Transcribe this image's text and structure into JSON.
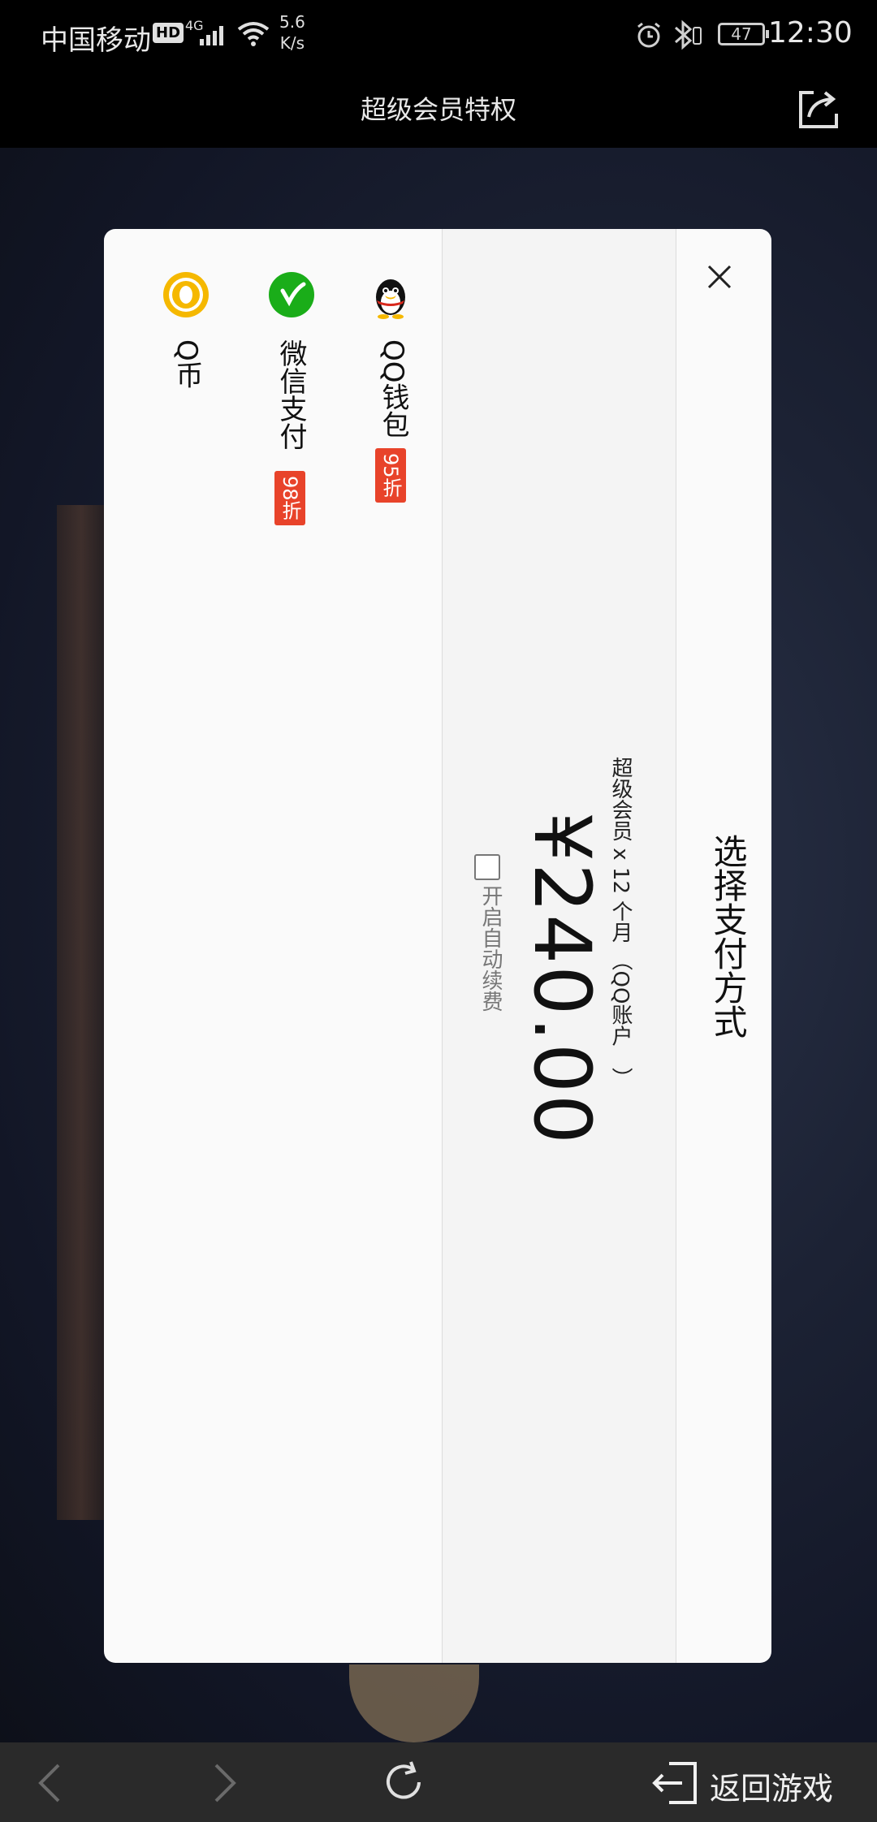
{
  "status_bar": {
    "carrier": "中国移动",
    "hd": "HD",
    "network": "4G",
    "speed_value": "5.6",
    "speed_unit": "K/s",
    "battery": "47",
    "time": "12:30"
  },
  "header": {
    "title": "超级会员特权"
  },
  "payment_sheet": {
    "title": "选择支付方式",
    "product": "超级会员 x 12 个月 （QQ账户　）",
    "price": "¥240.00",
    "auto_renew_label": "开启自动续费",
    "auto_renew_checked": false,
    "methods": [
      {
        "label": "QQ钱包",
        "badge": "95折",
        "icon": "qq-penguin-icon"
      },
      {
        "label": "微信支付",
        "badge": "98折",
        "icon": "wechat-pay-icon"
      },
      {
        "label": "Q币",
        "badge": "",
        "icon": "q-coin-icon"
      }
    ]
  },
  "bottom_nav": {
    "exit_label": "返回游戏"
  },
  "colors": {
    "badge": "#e8432a",
    "wechat_green": "#1aad19",
    "qcoin_yellow": "#f5b800"
  }
}
